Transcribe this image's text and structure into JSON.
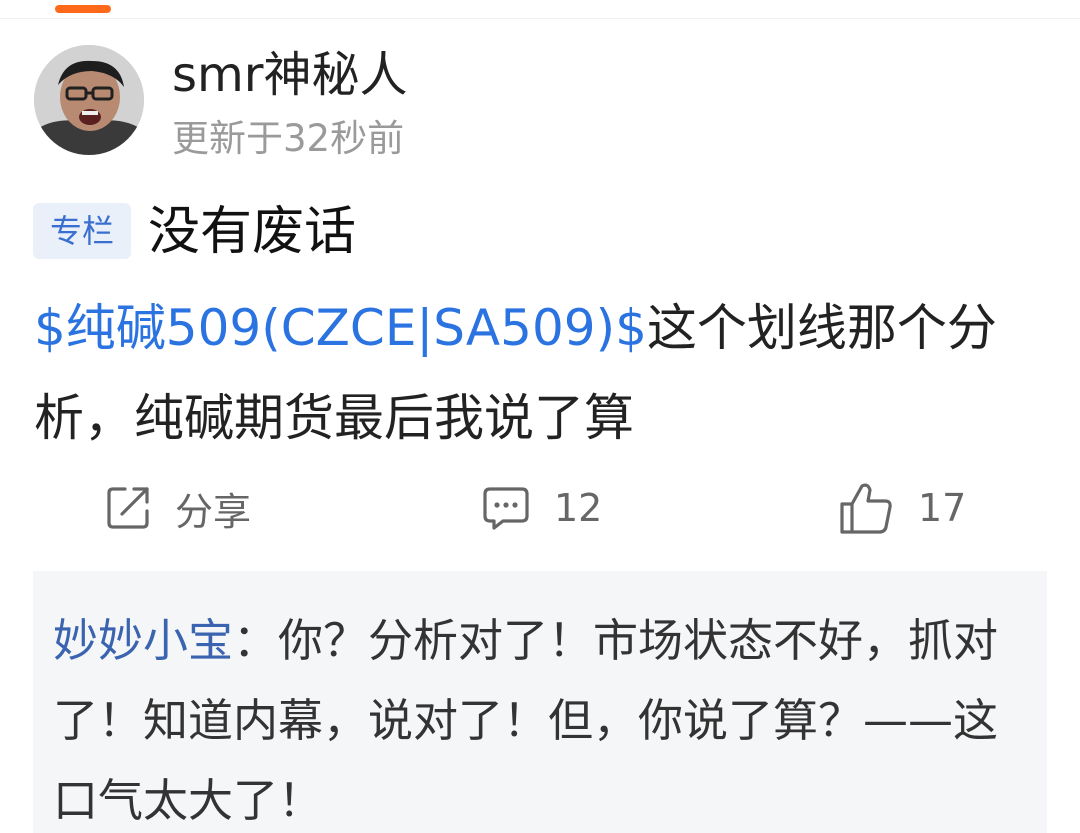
{
  "header": {
    "author_name": "smr神秘人",
    "update_time": "更新于32秒前"
  },
  "post": {
    "badge": "专栏",
    "title": "没有废话",
    "stock_link": "$纯碱509(CZCE|SA509)$",
    "body_text": "这个划线那个分析，纯碱期货最后我说了算"
  },
  "actions": {
    "share_label": "分享",
    "comment_count": "12",
    "like_count": "17"
  },
  "comment": {
    "author": "妙妙小宝",
    "text": "：你？分析对了！市场状态不好，抓对了！知道内幕，说对了！但，你说了算？——这口气太大了！"
  },
  "icons": {
    "share": "share-icon",
    "comment": "comment-icon",
    "like": "thumbs-up-icon"
  },
  "colors": {
    "accent": "#ff6a1a",
    "link": "#2a73e0",
    "commenter": "#3b64b0",
    "badge_bg": "#eaf0fa"
  }
}
